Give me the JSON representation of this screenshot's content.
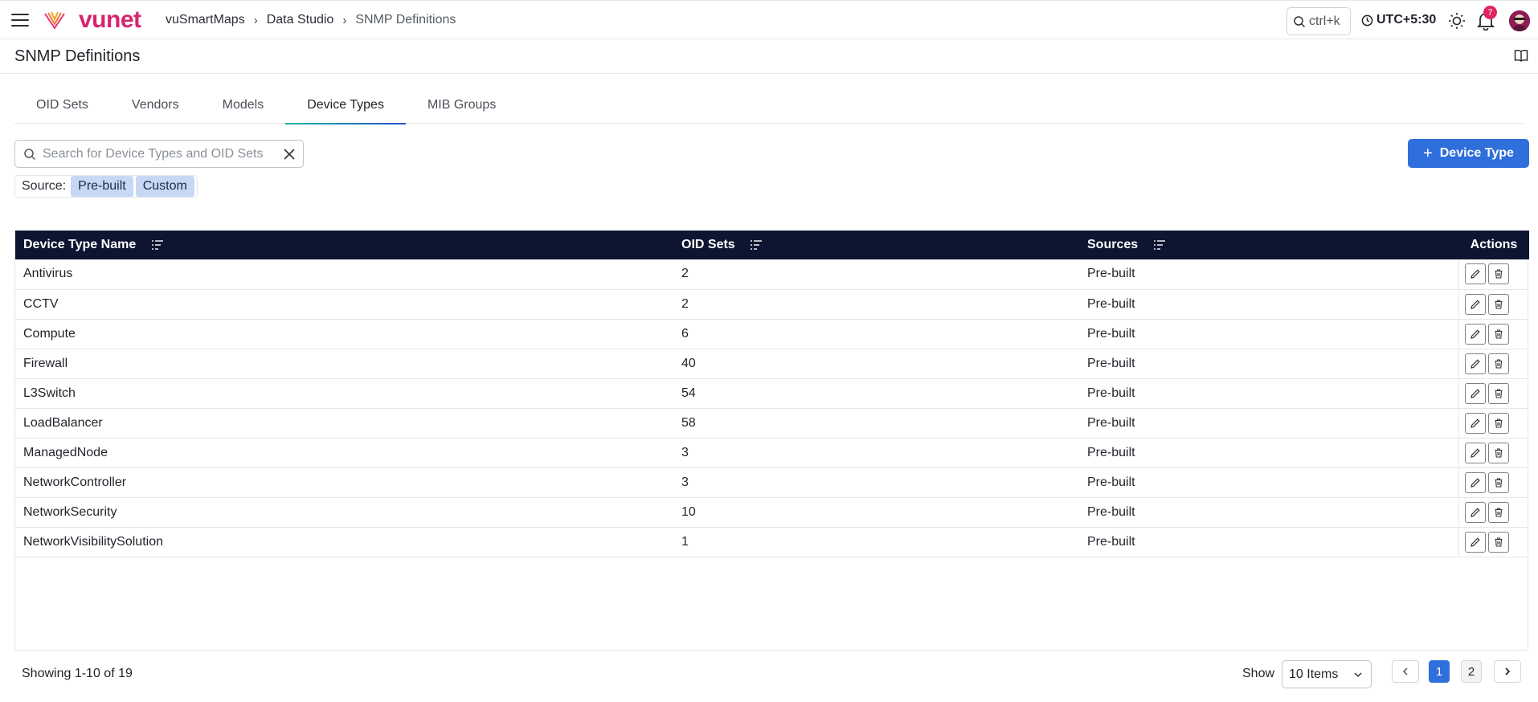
{
  "app": {
    "brand": "vunet",
    "colors": {
      "accent": "#2f6fdc",
      "brand": "#d6246e",
      "table_header": "#0d1530",
      "chip": "#c7d8f4"
    }
  },
  "header": {
    "breadcrumb": [
      "vuSmartMaps",
      "Data Studio",
      "SNMP Definitions"
    ],
    "search_shortcut": "ctrl+k",
    "timezone": "UTC+5:30",
    "notification_count": "7"
  },
  "page": {
    "title": "SNMP Definitions"
  },
  "tabs": [
    {
      "label": "OID Sets",
      "active": false
    },
    {
      "label": "Vendors",
      "active": false
    },
    {
      "label": "Models",
      "active": false
    },
    {
      "label": "Device Types",
      "active": true
    },
    {
      "label": "MIB Groups",
      "active": false
    }
  ],
  "search": {
    "placeholder": "Search for Device Types and OID Sets",
    "value": ""
  },
  "add_button": {
    "label": "Device Type"
  },
  "source_filter": {
    "label": "Source:",
    "chips": [
      "Pre-built",
      "Custom"
    ]
  },
  "table": {
    "columns": [
      "Device Type Name",
      "OID Sets",
      "Sources",
      "Actions"
    ],
    "rows": [
      {
        "name": "Antivirus",
        "oid_sets": "2",
        "source": "Pre-built"
      },
      {
        "name": "CCTV",
        "oid_sets": "2",
        "source": "Pre-built"
      },
      {
        "name": "Compute",
        "oid_sets": "6",
        "source": "Pre-built"
      },
      {
        "name": "Firewall",
        "oid_sets": "40",
        "source": "Pre-built"
      },
      {
        "name": "L3Switch",
        "oid_sets": "54",
        "source": "Pre-built"
      },
      {
        "name": "LoadBalancer",
        "oid_sets": "58",
        "source": "Pre-built"
      },
      {
        "name": "ManagedNode",
        "oid_sets": "3",
        "source": "Pre-built"
      },
      {
        "name": "NetworkController",
        "oid_sets": "3",
        "source": "Pre-built"
      },
      {
        "name": "NetworkSecurity",
        "oid_sets": "10",
        "source": "Pre-built"
      },
      {
        "name": "NetworkVisibilitySolution",
        "oid_sets": "1",
        "source": "Pre-built"
      }
    ]
  },
  "footer": {
    "showing": "Showing 1-10 of 19",
    "show_label": "Show",
    "page_size": "10 Items",
    "pages": [
      "1",
      "2"
    ],
    "current_page": "1"
  }
}
